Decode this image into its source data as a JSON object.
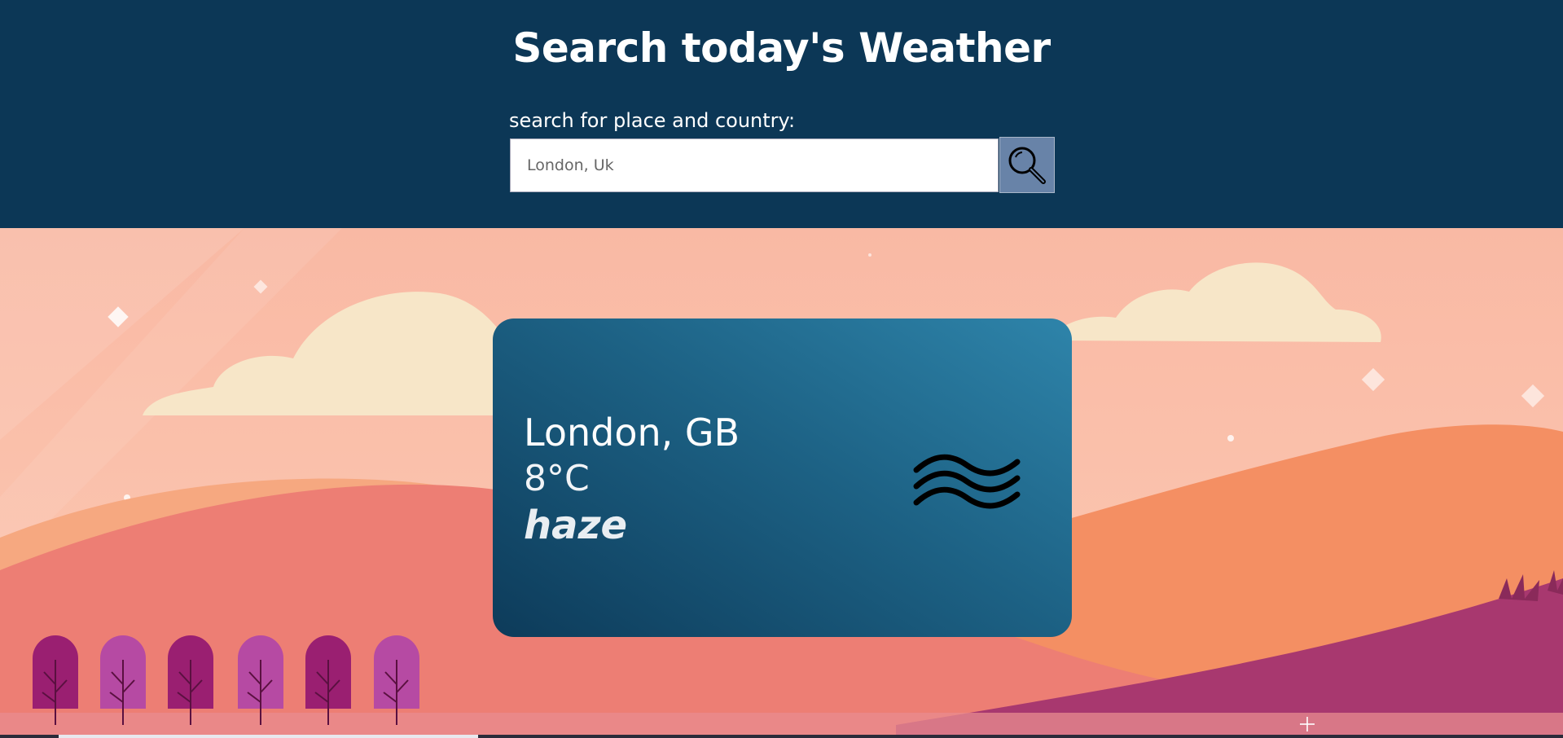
{
  "header": {
    "title": "Search today's Weather",
    "search_label": "search for place and country:",
    "search_placeholder": "London, Uk",
    "search_value": ""
  },
  "weather": {
    "city": "London, GB",
    "temperature": "8°C",
    "description": "haze",
    "icon": "haze-icon"
  },
  "icons": {
    "search": "magnifier-icon"
  },
  "colors": {
    "header_bg": "#0c3756",
    "search_button_bg": "#6883a8",
    "card_gradient_start": "#0d3b5a",
    "card_gradient_end": "#2e84aa",
    "sky": "#f8b9a3",
    "hill_orange": "#f48f63",
    "hill_purple": "#a8386f"
  }
}
